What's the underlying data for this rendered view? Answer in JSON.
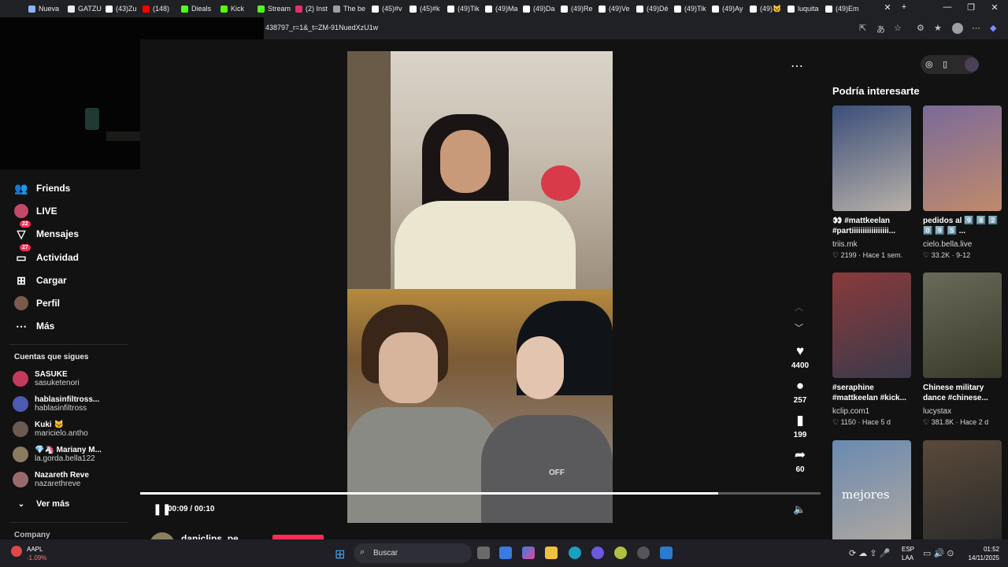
{
  "browser": {
    "tabs": [
      {
        "label": "Nueva",
        "color": "#8ab4f8"
      },
      {
        "label": "GATZU",
        "color": "#e8eaed"
      },
      {
        "label": "(43)Zu",
        "color": "#ffffff"
      },
      {
        "label": "(148) ",
        "color": "#ff0000"
      },
      {
        "label": "Dieals",
        "color": "#53fc18"
      },
      {
        "label": "Kick",
        "color": "#53fc18"
      },
      {
        "label": "Stream",
        "color": "#53fc18"
      },
      {
        "label": "(2) Inst",
        "color": "#e1306c"
      },
      {
        "label": "The be",
        "color": "#9aa0a6"
      },
      {
        "label": "(45)#v",
        "color": "#ffffff"
      },
      {
        "label": "(45)#k",
        "color": "#ffffff"
      },
      {
        "label": "(49)Tik",
        "color": "#ffffff"
      },
      {
        "label": "(49)Ma",
        "color": "#ffffff"
      },
      {
        "label": "(49)Da",
        "color": "#ffffff"
      },
      {
        "label": "(49)Re",
        "color": "#ffffff"
      },
      {
        "label": "(49)Ve",
        "color": "#ffffff"
      },
      {
        "label": "(49)Dé",
        "color": "#ffffff"
      },
      {
        "label": "(49)Tik",
        "color": "#ffffff"
      },
      {
        "label": "(49)Ay",
        "color": "#ffffff"
      },
      {
        "label": "(49)🐱",
        "color": "#ffffff"
      },
      {
        "label": "luquita",
        "color": "#ffffff"
      },
      {
        "label": "(49)Em",
        "color": "#ffffff"
      }
    ],
    "url": "438797_r=1&_t=ZM-91NuedXzU1w"
  },
  "sidebar": {
    "items": [
      {
        "label": "Friends",
        "icon": "friends-icon"
      },
      {
        "label": "LIVE",
        "icon": "live-icon"
      },
      {
        "label": "Mensajes",
        "icon": "messages-icon",
        "badge": "22"
      },
      {
        "label": "Actividad",
        "icon": "activity-icon",
        "badge": "27"
      },
      {
        "label": "Cargar",
        "icon": "upload-icon"
      },
      {
        "label": "Perfil",
        "icon": "profile-icon"
      },
      {
        "label": "Más",
        "icon": "more-icon"
      }
    ],
    "following_title": "Cuentas que sigues",
    "following": [
      {
        "name": "SASUKE",
        "handle": "sasuketenori",
        "color": "#c23b5a"
      },
      {
        "name": "hablasinfiltross...",
        "handle": "hablasinfiltross",
        "color": "#4b5bb0"
      },
      {
        "name": "Kuki 🐱",
        "handle": "maricielo.antho",
        "color": "#6b5a50"
      },
      {
        "name": "💎🦄 Mariany M...",
        "handle": "la.gorda.bella122",
        "color": "#8a7a60"
      },
      {
        "name": "Nazareth Reve",
        "handle": "nazarethreve",
        "color": "#9a6a6a"
      }
    ],
    "see_more": "Ver más",
    "company": "Company"
  },
  "player": {
    "time": "00:09 / 00:10",
    "progress": 0.85,
    "author": "daniclips_pe",
    "actions": [
      {
        "icon": "heart-icon",
        "count": "4400"
      },
      {
        "icon": "comment-icon",
        "count": "257"
      },
      {
        "icon": "bookmark-icon",
        "count": "199"
      },
      {
        "icon": "share-icon",
        "count": "60"
      }
    ],
    "overlay_text": "OFF"
  },
  "suggestions": {
    "title": "Podría interesarte",
    "items": [
      {
        "caption": "👀 #mattkeelan #partiiiiiiiiiiiiiiiii...",
        "author": "triis.mk",
        "stats": "♡ 2199 · Hace 1 sem.",
        "color1": "#3c4f7a",
        "color2": "#b7b0a8"
      },
      {
        "caption": "pedidos al 9️⃣ 8️⃣ 2️⃣ 0️⃣ 9️⃣ 5️⃣ ...",
        "author": "cielo.bella.live",
        "stats": "♡ 33.2K · 9-12",
        "color1": "#7a6a9a",
        "color2": "#c08a6a"
      },
      {
        "caption": "#seraphine #mattkeelan #kick...",
        "author": "kclip.com1",
        "stats": "♡ 1150 · Hace 5 d",
        "color1": "#8a3a3a",
        "color2": "#3a3a4a"
      },
      {
        "caption": "Chinese military dance #chinese...",
        "author": "lucystax",
        "stats": "♡ 381.8K · Hace 2 d",
        "color1": "#6a6a5a",
        "color2": "#3a3a2a"
      },
      {
        "caption": "",
        "author": "",
        "stats": "",
        "color1": "#6a8ab0",
        "color2": "#b0a8a0"
      },
      {
        "caption": "",
        "author": "",
        "stats": "",
        "color1": "#5a4a3a",
        "color2": "#2a2a2a"
      }
    ],
    "thumb_text": [
      "",
      "",
      "",
      "",
      "mejores",
      ""
    ]
  },
  "taskbar": {
    "stock_name": "AAPL",
    "stock_change": "-1.09%",
    "search": "Buscar",
    "lang1": "ESP",
    "lang2": "LAA",
    "time": "01:52",
    "date": "14/11/2025"
  }
}
